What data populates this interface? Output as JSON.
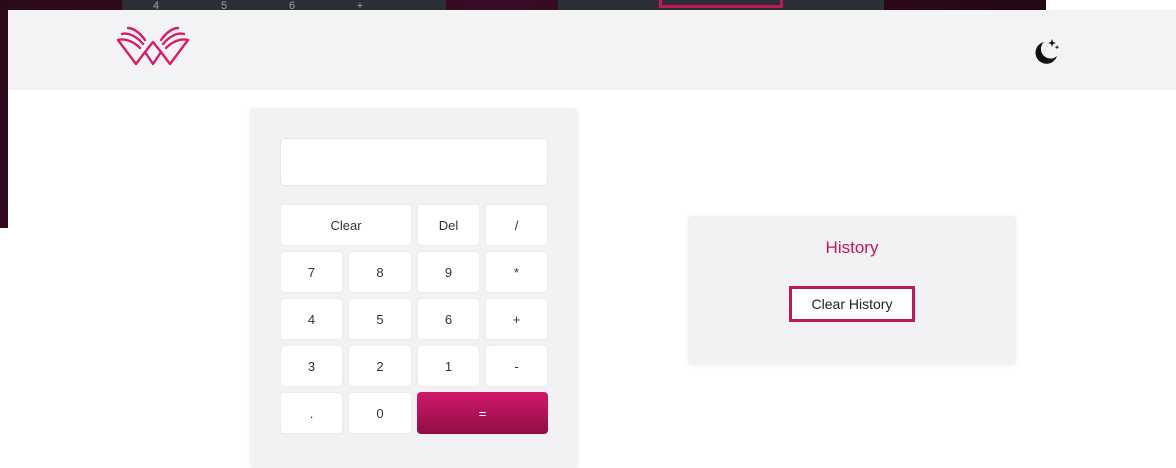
{
  "background": {
    "top_row_keys": [
      "4",
      "5",
      "6",
      "+"
    ]
  },
  "navbar": {
    "logo_icon": "winged-logo-icon",
    "theme_toggle_icon": "moon-stars-icon"
  },
  "calculator": {
    "display_value": "",
    "keys": {
      "clear": "Clear",
      "del": "Del",
      "divide": "/",
      "k7": "7",
      "k8": "8",
      "k9": "9",
      "multiply": "*",
      "k4": "4",
      "k5": "5",
      "k6": "6",
      "plus": "+",
      "k3": "3",
      "k2": "2",
      "k1": "1",
      "minus": "-",
      "dot": ".",
      "k0": "0",
      "equals": "="
    }
  },
  "history": {
    "title": "History",
    "clear_button": "Clear History"
  },
  "colors": {
    "accent": "#c2185b",
    "navbar_bg": "#f3f3f6",
    "card_bg": "#f2f2f5"
  }
}
